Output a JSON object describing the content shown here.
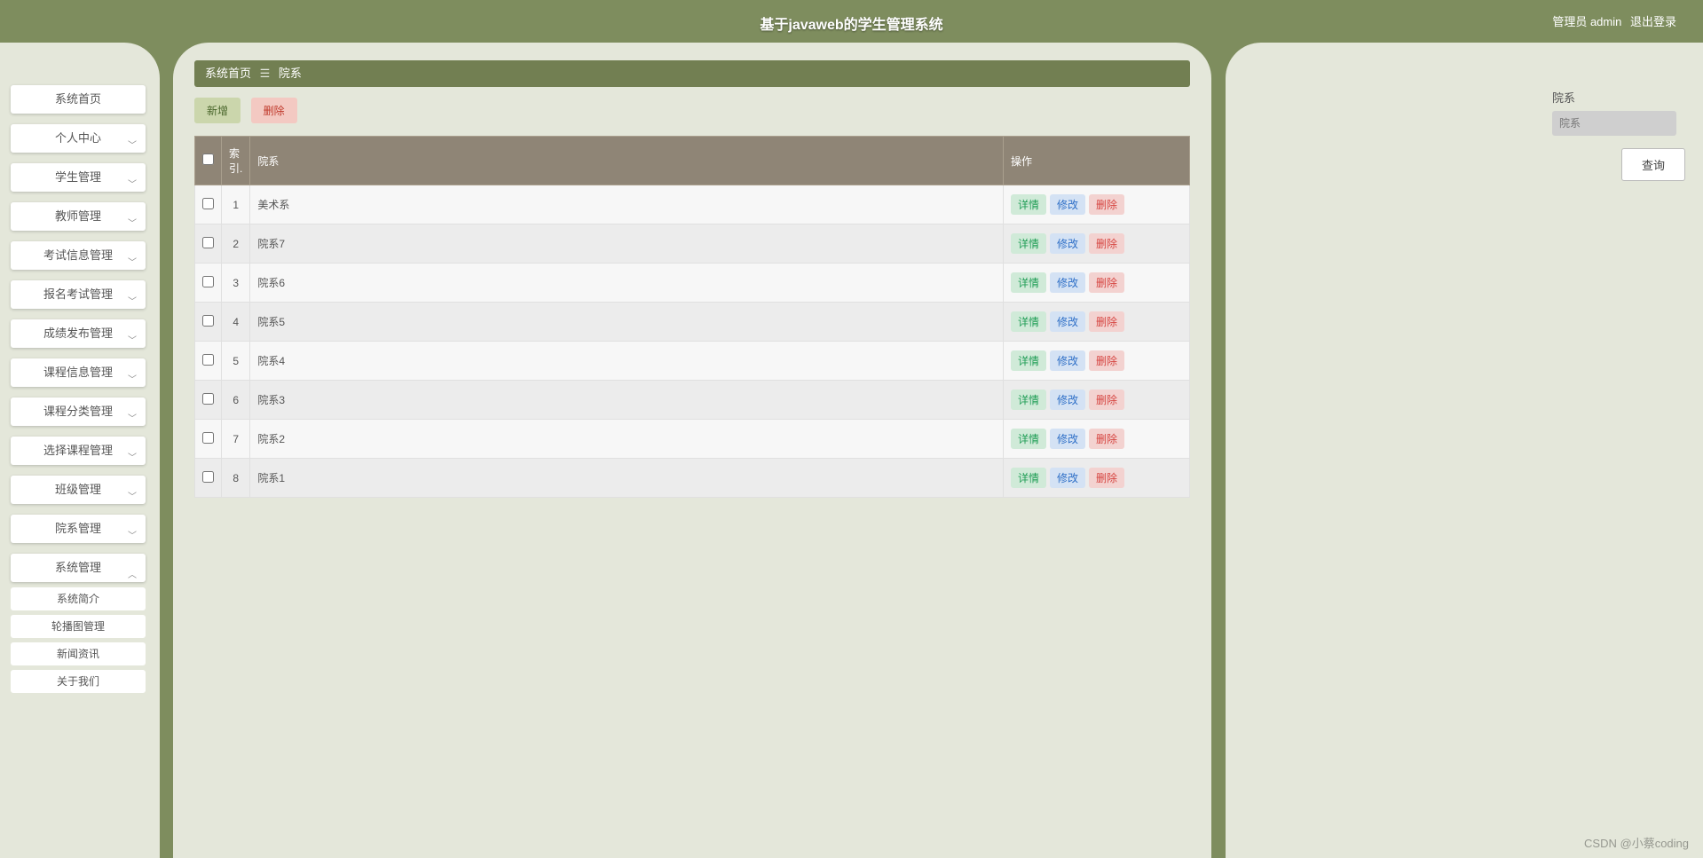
{
  "header": {
    "title": "基于javaweb的学生管理系统",
    "admin_label": "管理员 admin",
    "logout_label": "退出登录"
  },
  "sidebar": {
    "items": [
      {
        "label": "系统首页",
        "expand": false
      },
      {
        "label": "个人中心",
        "expand": true
      },
      {
        "label": "学生管理",
        "expand": true
      },
      {
        "label": "教师管理",
        "expand": true
      },
      {
        "label": "考试信息管理",
        "expand": true
      },
      {
        "label": "报名考试管理",
        "expand": true
      },
      {
        "label": "成绩发布管理",
        "expand": true
      },
      {
        "label": "课程信息管理",
        "expand": true
      },
      {
        "label": "课程分类管理",
        "expand": true
      },
      {
        "label": "选择课程管理",
        "expand": true
      },
      {
        "label": "班级管理",
        "expand": true
      },
      {
        "label": "院系管理",
        "expand": true
      },
      {
        "label": "系统管理",
        "expand": true
      }
    ],
    "subitems": [
      {
        "label": "系统简介"
      },
      {
        "label": "轮播图管理"
      },
      {
        "label": "新闻资讯"
      },
      {
        "label": "关于我们"
      }
    ]
  },
  "crumb": {
    "home": "系统首页",
    "sep": "☰",
    "current": "院系"
  },
  "toolbar": {
    "add_label": "新增",
    "del_label": "删除"
  },
  "table": {
    "headers": {
      "index": "索引.",
      "name": "院系",
      "ops": "操作"
    },
    "op_labels": {
      "detail": "详情",
      "edit": "修改",
      "del": "删除"
    },
    "rows": [
      {
        "idx": "1",
        "name": "美术系"
      },
      {
        "idx": "2",
        "name": "院系7"
      },
      {
        "idx": "3",
        "name": "院系6"
      },
      {
        "idx": "4",
        "name": "院系5"
      },
      {
        "idx": "5",
        "name": "院系4"
      },
      {
        "idx": "6",
        "name": "院系3"
      },
      {
        "idx": "7",
        "name": "院系2"
      },
      {
        "idx": "8",
        "name": "院系1"
      }
    ]
  },
  "filter": {
    "label": "院系",
    "placeholder": "院系",
    "query_label": "查询"
  },
  "watermark": "CSDN @小蔡coding"
}
